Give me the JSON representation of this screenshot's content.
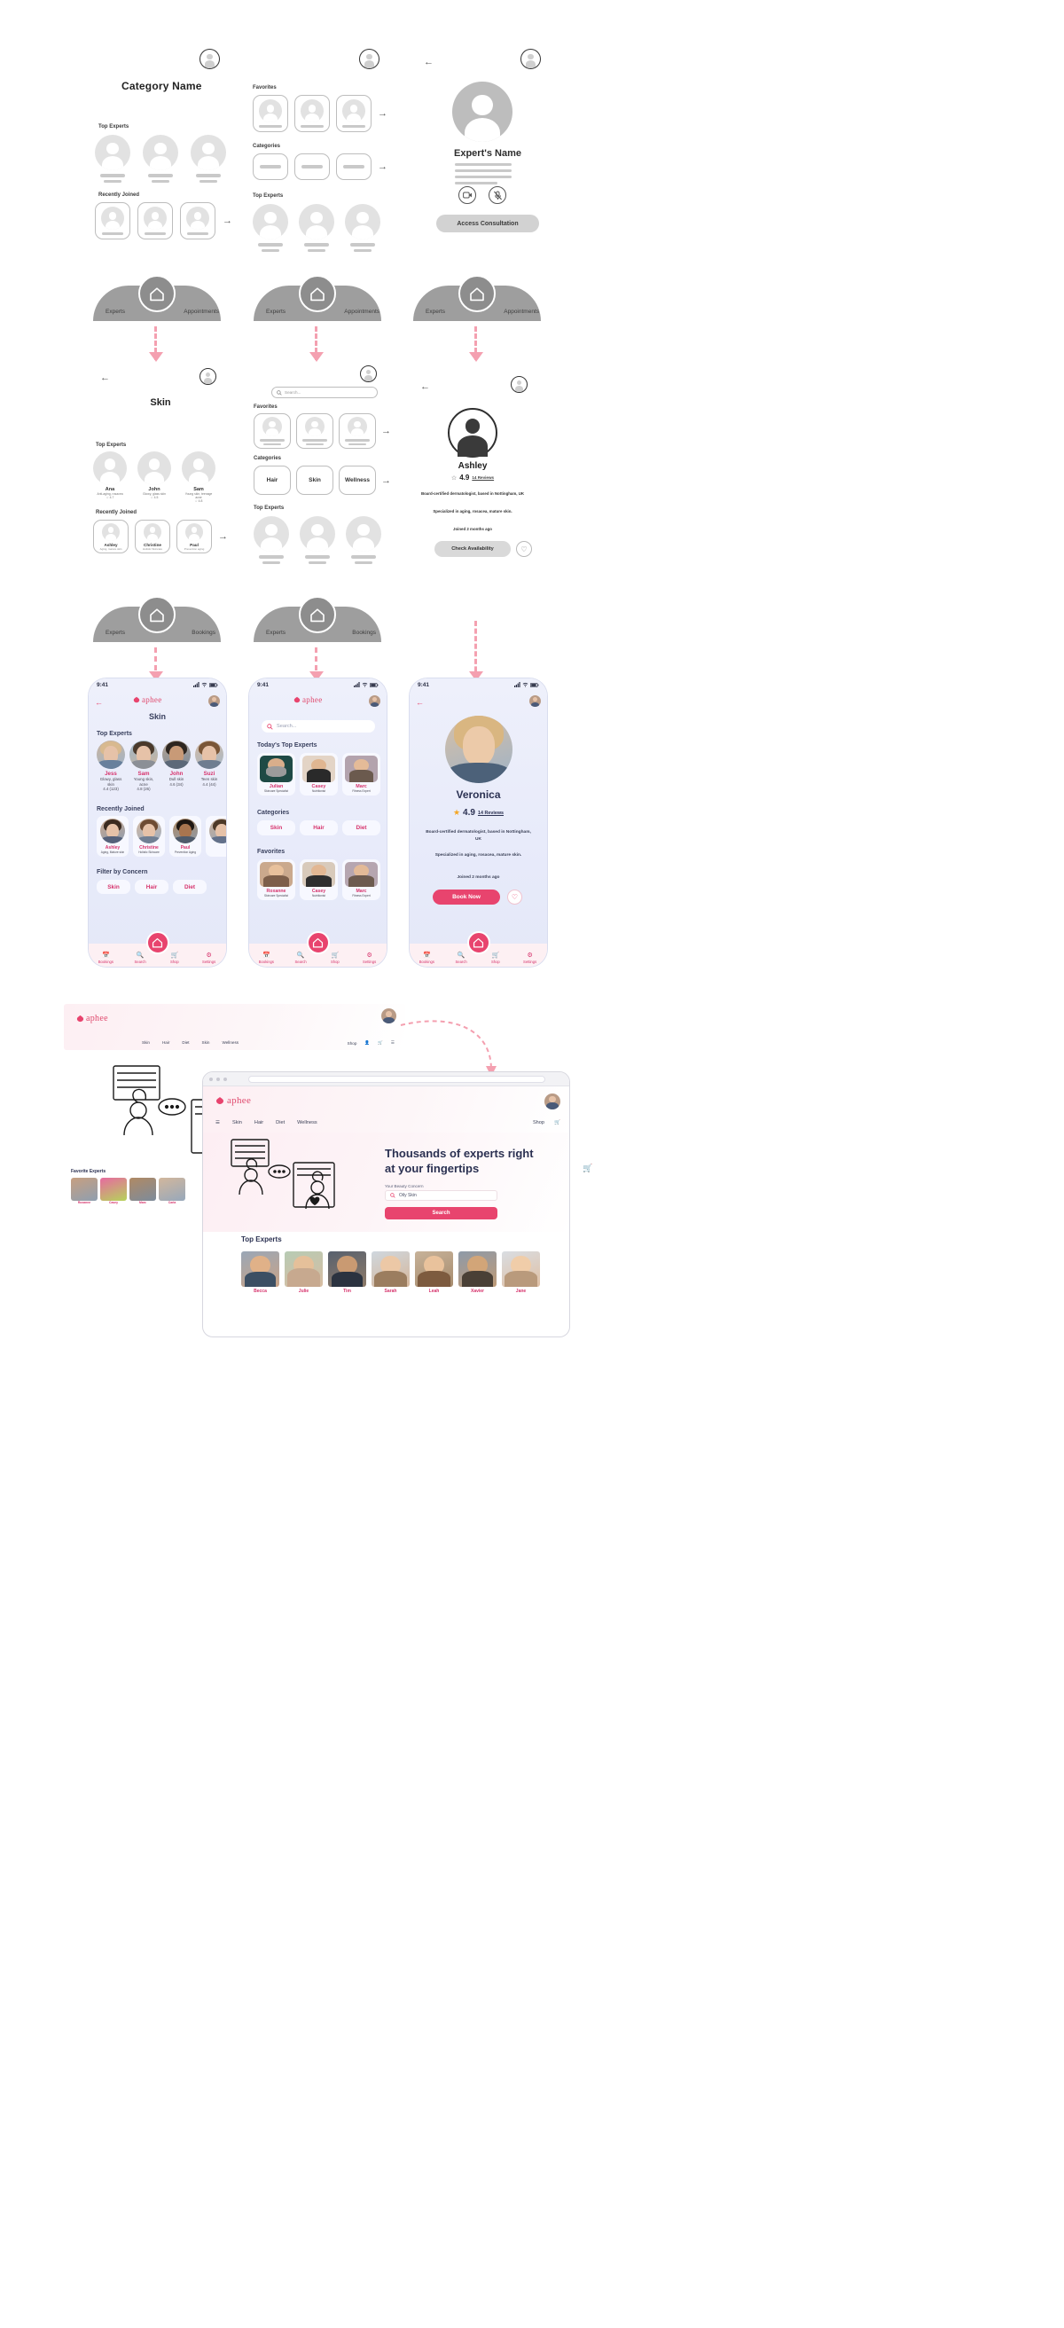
{
  "brand": {
    "name": "aphee",
    "accent": "#e8446e",
    "accent_dark": "#d6336c",
    "ink": "#39405e"
  },
  "wireframes": {
    "row1": {
      "screen1": {
        "title": "Category Name",
        "sections": [
          "Top Experts",
          "Recently Joined"
        ]
      },
      "screen2": {
        "sections": [
          "Favorites",
          "Categories",
          "Top Experts"
        ]
      },
      "screen3": {
        "title": "Expert's Name",
        "button": "Access Consultation",
        "back_icon": "back-arrow-icon",
        "video_icon": "video-camera-icon",
        "mic_icon": "mic-off-icon"
      }
    },
    "nav": {
      "left": "Experts",
      "right_a": "Appointments",
      "right_b": "Bookings",
      "home_icon": "home-icon"
    }
  },
  "midfi": {
    "screen1": {
      "title": "Skin",
      "top_experts_label": "Top Experts",
      "recently_joined_label": "Recently Joined",
      "top_experts": [
        {
          "name": "Ana",
          "spec": "Anti-aging, rosacea",
          "rating": "4.7"
        },
        {
          "name": "John",
          "spec": "Glowy, glass skin",
          "rating": "4.5"
        },
        {
          "name": "Sam",
          "spec": "Young skin, teenage acne",
          "rating": "4.8"
        }
      ],
      "recently_joined": [
        {
          "name": "Ashley",
          "spec": "Aging, mature skin"
        },
        {
          "name": "Christine",
          "spec": "Holistic Skincare"
        },
        {
          "name": "Paul",
          "spec": "Prevention aging"
        }
      ]
    },
    "screen2": {
      "search_placeholder": "Search...",
      "favorites_label": "Favorites",
      "categories_label": "Categories",
      "top_experts_label": "Top Experts",
      "categories": [
        "Hair",
        "Skin",
        "Wellness"
      ]
    },
    "screen3": {
      "name": "Ashley",
      "rating": "4.9",
      "reviews": "14 Reviews",
      "bio1": "Board-certified dermatologist, based in Nottingham, UK",
      "bio2": "Specialized in aging, rosacea, mature skin.",
      "joined": "Joined 2 months ago",
      "button": "Check Availability",
      "heart_icon": "heart-icon"
    }
  },
  "phones": {
    "status": {
      "time": "9:41",
      "signal_icon": "cellular-icon",
      "wifi_icon": "wifi-icon",
      "battery_icon": "battery-icon"
    },
    "tabs": [
      {
        "label": "Bookings",
        "icon": "calendar-icon"
      },
      {
        "label": "Search",
        "icon": "search-icon"
      },
      {
        "label": "Shop",
        "icon": "cart-icon"
      },
      {
        "label": "Settings",
        "icon": "gear-icon"
      }
    ],
    "screen1": {
      "title": "Skin",
      "back_icon": "back-arrow-icon",
      "avatar_icon": "profile-avatar",
      "top_experts_label": "Top Experts",
      "recently_joined_label": "Recently Joined",
      "filter_label": "Filter by Concern",
      "top_experts": [
        {
          "name": "Jess",
          "spec": "Glowy, glass skin",
          "rating": "4.4 (123)"
        },
        {
          "name": "Sam",
          "spec": "Young skin, acne",
          "rating": "4.8 (26)"
        },
        {
          "name": "John",
          "spec": "Dull skin",
          "rating": "4.6 (34)"
        },
        {
          "name": "Suzi",
          "spec": "Teen skin",
          "rating": "4.4 (44)"
        }
      ],
      "recently_joined": [
        {
          "name": "Ashley",
          "spec": "Aging, Mature skin"
        },
        {
          "name": "Christine",
          "spec": "Holistic Skincare"
        },
        {
          "name": "Paul",
          "spec": "Prevention Aging"
        }
      ],
      "filters": [
        "Skin",
        "Hair",
        "Diet"
      ]
    },
    "screen2": {
      "search_placeholder": "Search...",
      "today_label": "Today's Top Experts",
      "categories_label": "Categories",
      "favorites_label": "Favorites",
      "today_experts": [
        {
          "name": "Julian",
          "spec": "Skincare Specialist"
        },
        {
          "name": "Casey",
          "spec": "Nutritionist"
        },
        {
          "name": "Marc",
          "spec": "Fitness Expert"
        }
      ],
      "categories": [
        "Skin",
        "Hair",
        "Diet"
      ],
      "favorites": [
        {
          "name": "Roxanne",
          "spec": "Skincare Specialist"
        },
        {
          "name": "Casey",
          "spec": "Nutritionist"
        },
        {
          "name": "Marc",
          "spec": "Fitness Expert"
        }
      ]
    },
    "screen3": {
      "name": "Veronica",
      "rating": "4.9",
      "reviews": "14 Reviews",
      "star_icon": "star-icon",
      "bio1": "Board-certified dermatologist, based in Nottingham, UK",
      "bio2": "Specialized in aging, rosacea, mature skin.",
      "joined": "Joined 2 months ago",
      "button": "Book Now",
      "heart_icon": "heart-icon"
    }
  },
  "web": {
    "logo": "aphee",
    "nav": [
      "Skin",
      "Hair",
      "Diet",
      "Wellness"
    ],
    "nav_right": [
      "Shop"
    ],
    "icons": [
      "user-icon",
      "cart-icon",
      "menu-icon"
    ],
    "hero_title": "Thousands of experts right at your fingertips",
    "concern_label": "Your Beauty Concern",
    "concern_value": "Oily Skin",
    "search_button": "Search",
    "top_experts_label": "Top Experts",
    "top_experts": [
      "Becca",
      "Julie",
      "Tim",
      "Sarah",
      "Leah",
      "Xavier",
      "Jane"
    ],
    "favorites_label": "Favorite Experts",
    "favorites": [
      "Roxanne",
      "Casey",
      "Marc",
      "Carla"
    ]
  }
}
